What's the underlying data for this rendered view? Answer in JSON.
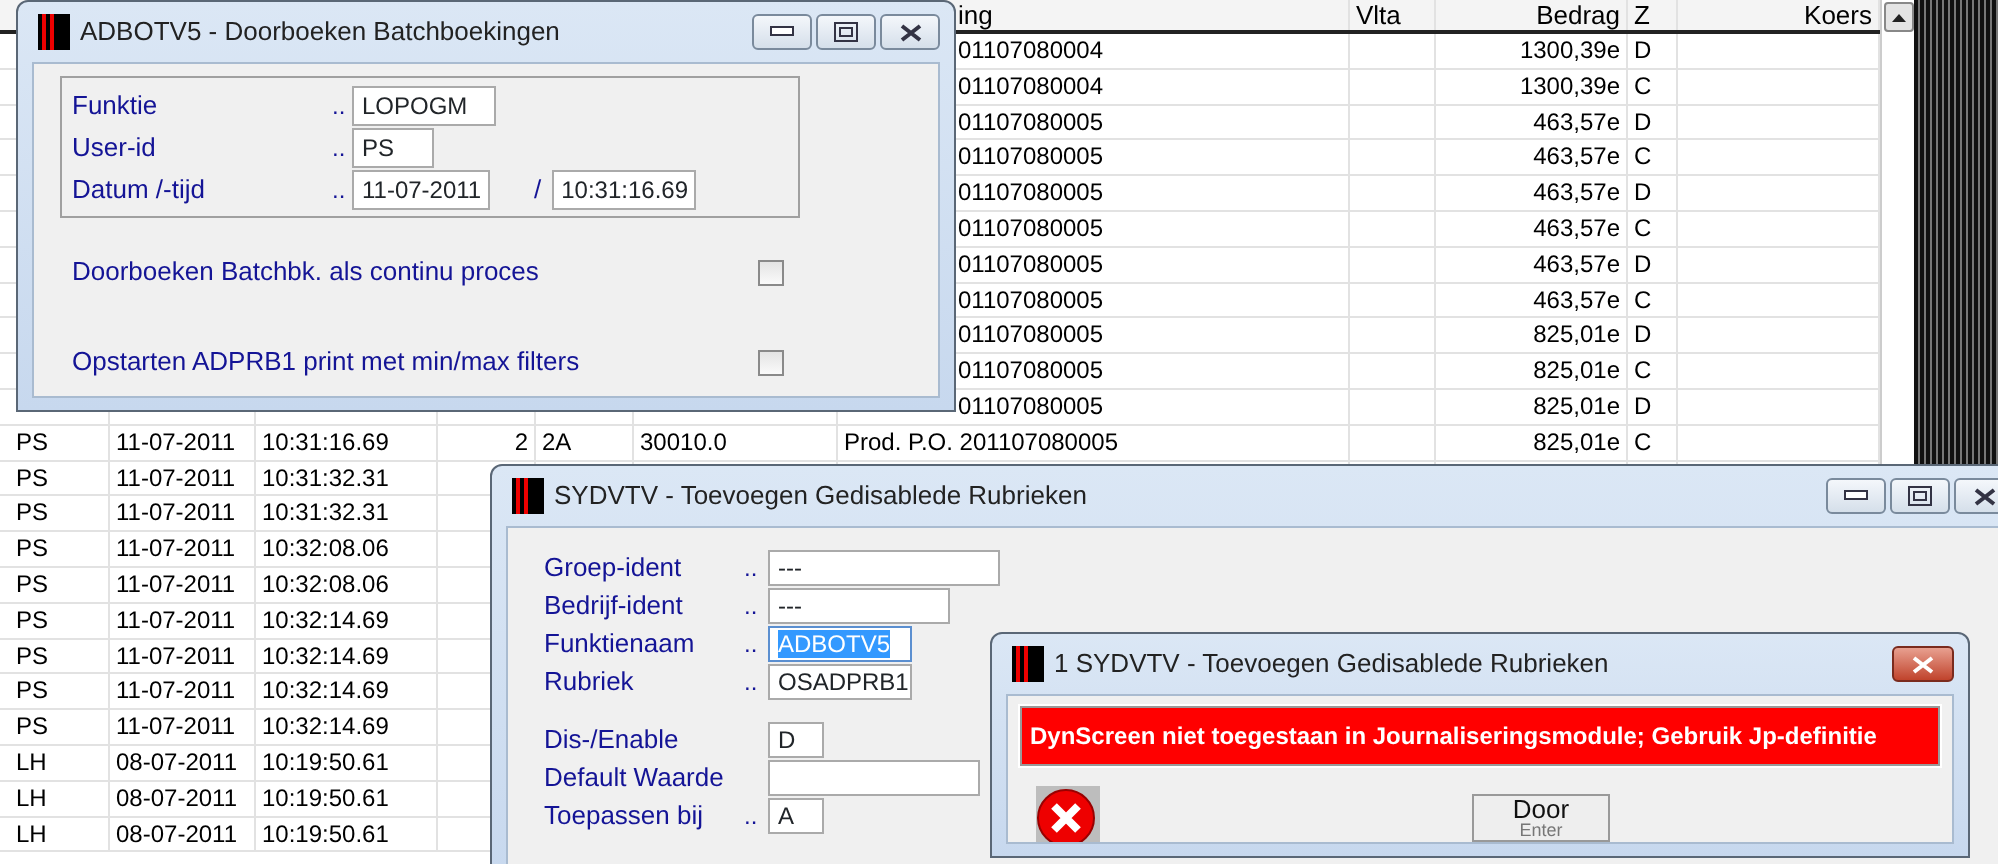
{
  "table": {
    "columns": [
      {
        "label": "ing"
      },
      {
        "label": "Vlta"
      },
      {
        "label": "Bedrag"
      },
      {
        "label": "Z"
      },
      {
        "label": "Koers"
      }
    ],
    "rows": [
      {
        "column_7": "01107080004",
        "column_9": "1300,39e",
        "column_10": "D"
      },
      {
        "column_7": "01107080004",
        "column_9": "1300,39e",
        "column_10": "C"
      },
      {
        "column_7": "01107080005",
        "column_9": "463,57e",
        "column_10": "D"
      },
      {
        "column_7": "01107080005",
        "column_9": "463,57e",
        "column_10": "C"
      },
      {
        "column_7": "01107080005",
        "column_9": "463,57e",
        "column_10": "D"
      },
      {
        "column_7": "01107080005",
        "column_9": "463,57e",
        "column_10": "C"
      },
      {
        "column_7": "01107080005",
        "column_9": "463,57e",
        "column_10": "D"
      },
      {
        "column_7": "01107080005",
        "column_9": "463,57e",
        "column_10": "C"
      },
      {
        "column_7": "01107080005",
        "column_9": "825,01e",
        "column_10": "D"
      },
      {
        "column_7": "01107080005",
        "column_9": "825,01e",
        "column_10": "C"
      },
      {
        "column_7": "01107080005",
        "column_9": "825,01e",
        "column_10": "D"
      },
      {
        "column_1": "PS",
        "column_2": "11-07-2011",
        "column_3": "10:31:16.69",
        "column_4": "2",
        "column_5": "2A",
        "column_6": "30010.0",
        "column_7": "Prod. P.O. 201107080005",
        "column_9": "825,01e",
        "column_10": "C"
      },
      {
        "column_1": "PS",
        "column_2": "11-07-2011",
        "column_3": "10:31:32.31"
      },
      {
        "column_1": "PS",
        "column_2": "11-07-2011",
        "column_3": "10:31:32.31"
      },
      {
        "column_1": "PS",
        "column_2": "11-07-2011",
        "column_3": "10:32:08.06"
      },
      {
        "column_1": "PS",
        "column_2": "11-07-2011",
        "column_3": "10:32:08.06"
      },
      {
        "column_1": "PS",
        "column_2": "11-07-2011",
        "column_3": "10:32:14.69"
      },
      {
        "column_1": "PS",
        "column_2": "11-07-2011",
        "column_3": "10:32:14.69"
      },
      {
        "column_1": "PS",
        "column_2": "11-07-2011",
        "column_3": "10:32:14.69"
      },
      {
        "column_1": "PS",
        "column_2": "11-07-2011",
        "column_3": "10:32:14.69"
      },
      {
        "column_1": "LH",
        "column_2": "08-07-2011",
        "column_3": "10:19:50.61"
      },
      {
        "column_1": "LH",
        "column_2": "08-07-2011",
        "column_3": "10:19:50.61"
      },
      {
        "column_1": "LH",
        "column_2": "08-07-2011",
        "column_3": "10:19:50.61"
      }
    ]
  },
  "main_window": {
    "title": "ADBOTV5 - Doorboeken Batchboekingen",
    "fields": [
      {
        "label": "Funktie",
        "leader": "..",
        "value": "LOPOGM"
      },
      {
        "label": "User-id",
        "leader": "..",
        "value": "PS"
      },
      {
        "label": "Datum /-tijd",
        "leader": "..",
        "value": "11-07-2011",
        "separator": "/",
        "value_2": "10:31:16.69"
      }
    ],
    "options": [
      {
        "label": "Doorboeken Batchbk. als continu proces",
        "checked": false
      },
      {
        "label": "Opstarten ADPRB1 print met min/max filters",
        "checked": false
      }
    ]
  },
  "sub_window": {
    "title": "SYDVTV - Toevoegen Gedisablede Rubrieken",
    "fields": [
      {
        "label": "Groep-ident",
        "leader": "..",
        "value": "---",
        "selected": false
      },
      {
        "label": "Bedrijf-ident",
        "leader": "..",
        "value": "---",
        "selected": false
      },
      {
        "label": "Funktienaam",
        "leader": "..",
        "value": "ADBOTV5",
        "selected": true
      },
      {
        "label": "Rubriek",
        "leader": "..",
        "value": "OSADPRB1",
        "selected": false
      }
    ],
    "settings_fields": [
      {
        "label": "Dis-/Enable",
        "value": "D",
        "selected": false
      },
      {
        "label": "Default Waarde",
        "selected": false
      },
      {
        "label": "Toepassen bij",
        "leader": "..",
        "value": "A",
        "selected": false
      }
    ]
  },
  "dialog": {
    "title": "1 SYDVTV - Toevoegen Gedisablede Rubrieken",
    "message": "DynScreen niet toegestaan in Journaliseringsmodule; Gebruik Jp-definitie",
    "button": {
      "label": "Door",
      "shortcut": "Enter"
    }
  }
}
